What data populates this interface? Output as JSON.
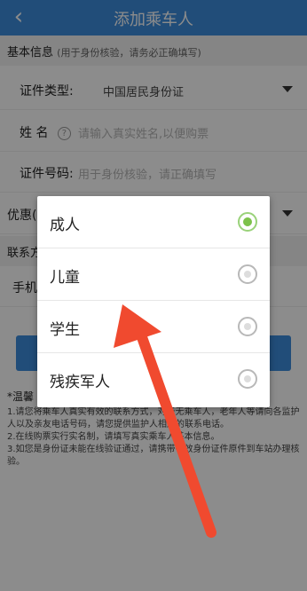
{
  "header": {
    "back_icon": "chevron-left-icon",
    "title": "添加乘车人"
  },
  "basic": {
    "title": "基本信息",
    "note": "(用于身份核验，请务必正确填写)"
  },
  "fields": {
    "id_type": {
      "label": "证件类型:",
      "value": "中国居民身份证"
    },
    "name": {
      "label": "姓  名",
      "help": "?",
      "placeholder": "请输入真实姓名,以便购票"
    },
    "id_number": {
      "label": "证件号码:",
      "placeholder": "用于身份核验，请正确填写"
    },
    "discount": {
      "label": "优惠("
    },
    "contact": {
      "label": "联系方"
    },
    "phone": {
      "label": "手机"
    }
  },
  "tips": {
    "title": "*温馨",
    "lines": [
      "1.请您将乘车人真实有效的联系方式，对于无乘车人，老年人等请向各监护人以及亲友电话号码，请您提供监护人相应的联系电话。",
      "2.在线购票实行实名制，请填写真实乘车人基本信息。",
      "3.如您是身份证未能在线验证通过，请携带有效身份证件原件到车站办理核验。"
    ]
  },
  "modal": {
    "options": [
      {
        "label": "成人",
        "checked": true
      },
      {
        "label": "儿童",
        "checked": false
      },
      {
        "label": "学生",
        "checked": false
      },
      {
        "label": "残疾军人",
        "checked": false
      }
    ]
  },
  "colors": {
    "header_bg": "#3d8cdc",
    "selected_radio": "#7cc24a",
    "annotation_arrow": "#f04a2f"
  }
}
